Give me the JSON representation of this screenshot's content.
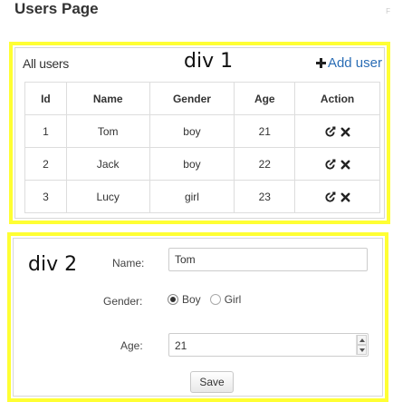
{
  "page": {
    "title": "Users Page",
    "corner_mark": "F"
  },
  "div1": {
    "label": "div 1",
    "all_users": "All users",
    "add_user": "Add user",
    "icons": {
      "add": "plus-icon",
      "edit": "edit-icon",
      "delete": "close-icon"
    },
    "table": {
      "headers": [
        "Id",
        "Name",
        "Gender",
        "Age",
        "Action"
      ],
      "rows": [
        {
          "id": "1",
          "name": "Tom",
          "gender": "boy",
          "age": "21"
        },
        {
          "id": "2",
          "name": "Jack",
          "gender": "boy",
          "age": "22"
        },
        {
          "id": "3",
          "name": "Lucy",
          "gender": "girl",
          "age": "23"
        }
      ]
    }
  },
  "div2": {
    "label": "div 2",
    "form": {
      "name_label": "Name:",
      "name_value": "Tom",
      "gender_label": "Gender:",
      "gender_options": [
        "Boy",
        "Girl"
      ],
      "gender_selected": "Boy",
      "age_label": "Age:",
      "age_value": "21",
      "save_label": "Save"
    }
  },
  "colors": {
    "highlight_border": "#ffff33",
    "link": "#2a6db5"
  }
}
